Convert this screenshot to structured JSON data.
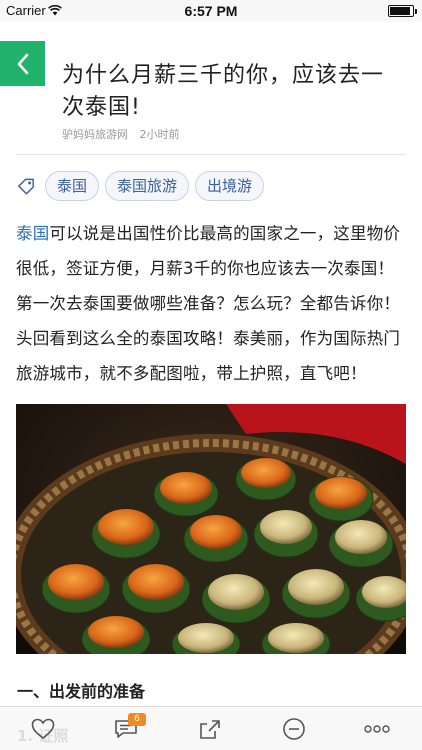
{
  "status_bar": {
    "carrier": "Carrier",
    "time": "6:57 PM"
  },
  "article": {
    "title": "为什么月薪三千的你，应该去一次泰国!",
    "source": "驴妈妈旅游网",
    "time_ago": "2小时前",
    "tags": [
      "泰国",
      "泰国旅游",
      "出境游"
    ],
    "body_link": "泰国",
    "body_text": "可以说是出国性价比最高的国家之一，这里物价很低，签证方便，月薪3千的你也应该去一次泰国！第一次去泰国要做哪些准备？怎么玩？全都告诉你！头回看到这么全的泰国攻略！泰美丽，作为国际热门旅游城市，就不多配图啦，带上护照，直飞吧！",
    "section_heading": "一、出发前的准备",
    "faded_text": "1. 证照"
  },
  "toolbar": {
    "comment_count": "6",
    "icons": [
      "heart-icon",
      "comment-icon",
      "share-icon",
      "minus-circle-icon",
      "more-icon"
    ]
  },
  "colors": {
    "accent": "#21b36b",
    "link": "#2a6ebb",
    "badge": "#f08a24"
  }
}
